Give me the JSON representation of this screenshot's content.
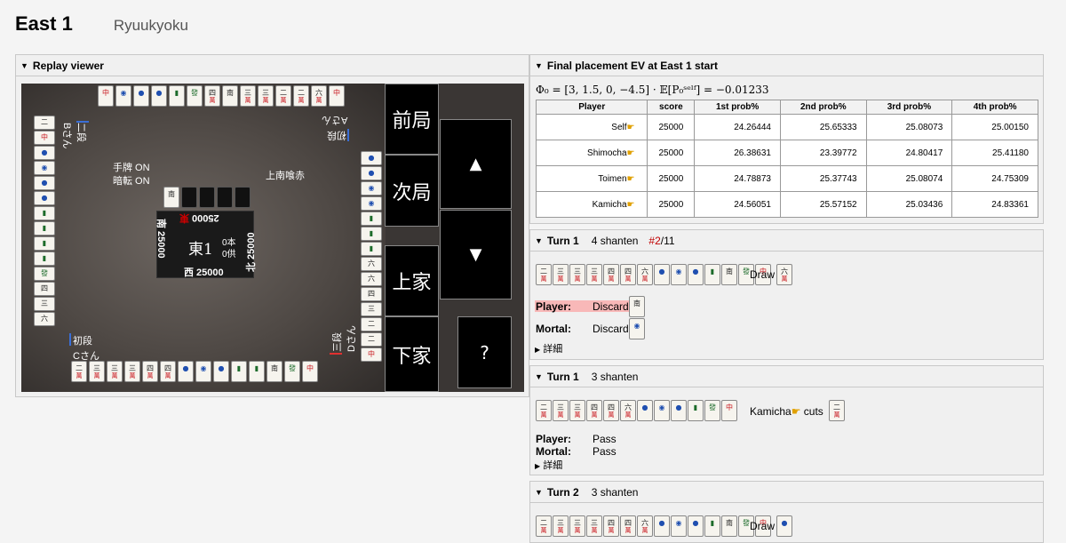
{
  "header": {
    "title": "East 1",
    "subtitle": "Ryuukyoku"
  },
  "replay": {
    "panel_title": "Replay viewer",
    "buttons": {
      "prev_round": "前局",
      "next_round": "次局",
      "kamicha": "上家",
      "shimocha": "下家",
      "up": "▲",
      "down": "▼",
      "help": "?"
    },
    "labels": {
      "hand_on": "手牌 ON",
      "riichi_on": "暗転 ON",
      "rules": "上南喰赤",
      "player_c_rank": "初段",
      "player_c_name": "Cさん",
      "player_a_name": "Aさん",
      "player_a_rank": "初段",
      "player_b_rank": "二段",
      "player_b_name": "Bさん",
      "player_d_rank": "三段",
      "player_d_name": "Dさん"
    },
    "center": {
      "round": "東1",
      "honba": "0本",
      "kyotaku": "0供",
      "west_score": "西 25000",
      "south_score": "南 25000",
      "north_score": "北 25000",
      "east_score": "25000",
      "east_mark": "東"
    }
  },
  "ev": {
    "panel_title": "Final placement EV at East 1 start",
    "formula": "Φ₀ = [3, 1.5, 0, −4.5] · 𝔼[P₀ˢᵉˡᶠ] = −0.01233",
    "columns": [
      "Player",
      "score",
      "1st prob%",
      "2nd prob%",
      "3rd prob%",
      "4th prob%"
    ],
    "rows": [
      {
        "player": "Self",
        "score": "25000",
        "p1": "24.26444",
        "p2": "25.65333",
        "p3": "25.08073",
        "p4": "25.00150"
      },
      {
        "player": "Shimocha",
        "score": "25000",
        "p1": "26.38631",
        "p2": "23.39772",
        "p3": "24.80417",
        "p4": "25.41180"
      },
      {
        "player": "Toimen",
        "score": "25000",
        "p1": "24.78873",
        "p2": "25.37743",
        "p3": "25.08074",
        "p4": "24.75309"
      },
      {
        "player": "Kamicha",
        "score": "25000",
        "p1": "24.56051",
        "p2": "25.57152",
        "p3": "25.03436",
        "p4": "24.83361"
      }
    ]
  },
  "turns": [
    {
      "title": "Turn 1",
      "shanten": "4 shanten",
      "rank_prefix": "#2",
      "rank_suffix": "/11",
      "action_text": "Draw",
      "player_label": "Player:",
      "player_action": "Discard",
      "mortal_label": "Mortal:",
      "mortal_action": "Discard",
      "details": "詳細"
    },
    {
      "title": "Turn 1",
      "shanten": "3 shanten",
      "action_who": "Kamicha",
      "action_text": "cuts",
      "player_label": "Player:",
      "player_action": "Pass",
      "mortal_label": "Mortal:",
      "mortal_action": "Pass",
      "details": "詳細"
    },
    {
      "title": "Turn 2",
      "shanten": "3 shanten",
      "action_text": "Draw"
    }
  ],
  "icons": {
    "pointer": "pointing-hand-icon",
    "collapse": "triangle-down-icon",
    "expand": "triangle-right-icon"
  }
}
